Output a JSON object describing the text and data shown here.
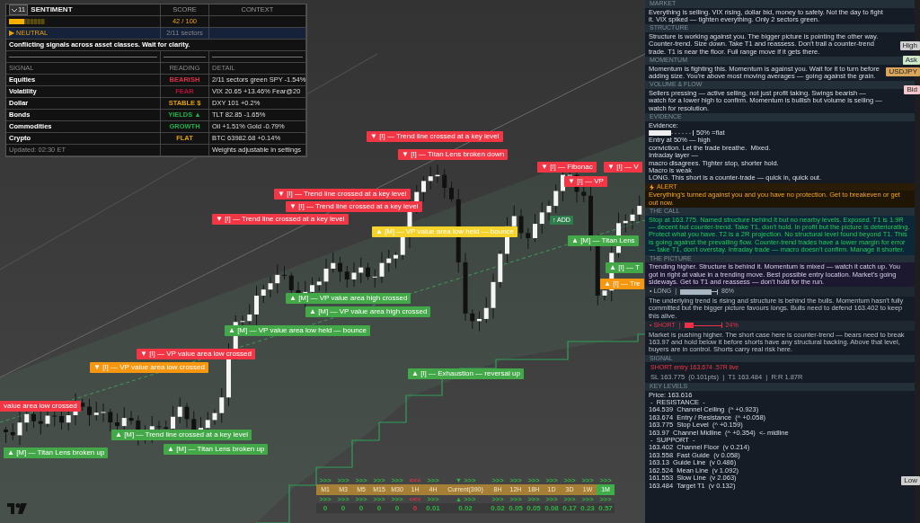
{
  "sentiment": {
    "badge": "11",
    "title": "SENTIMENT",
    "score_header": "SCORE",
    "context_header": "CONTEXT",
    "level": 0.42,
    "score": "42 / 100",
    "state": "▶ NEUTRAL",
    "sectors": "2/11 sectors",
    "summary": "Conflicting signals across asset classes. Wait for clarity.",
    "columns": [
      "SIGNAL",
      "READING",
      "DETAIL"
    ],
    "rows": [
      {
        "signal": "Equities",
        "reading": "BEARISH",
        "color": "#d9304a",
        "detail": "2/11 sectors green  SPY -1.54%"
      },
      {
        "signal": "Volatility",
        "reading": "FEAR",
        "color": "#b0143c",
        "detail": "VIX 20.65  +13.46%  Fear@20"
      },
      {
        "signal": "Dollar",
        "reading": "STABLE $",
        "color": "#e0a010",
        "detail": "DXY 101  +0.2%"
      },
      {
        "signal": "Bonds",
        "reading": "YIELDS ▲",
        "color": "#22b04a",
        "detail": "TLT 82.85  -1.65%"
      },
      {
        "signal": "Commodities",
        "reading": "GROWTH",
        "color": "#22b04a",
        "detail": "Oil +1.51%  Gold -0.79%"
      },
      {
        "signal": "Crypto",
        "reading": "FLAT",
        "color": "#e0a010",
        "detail": "BTC 63982.68  +0.14%"
      }
    ],
    "updated": "Updated: 02:30 ET",
    "note": "Weights adjustable in settings"
  },
  "signals": [
    {
      "text": "▼ [I] — Trend line crossed at a key level",
      "color": "#f23645"
    },
    {
      "text": "▼ [I] — Titan Lens broken down",
      "color": "#f23645"
    },
    {
      "text": "▼ [I] — Trend line crossed at a key level",
      "color": "#f23645"
    },
    {
      "text": "▼ [I] — Trend line crossed at a key level",
      "color": "#f23645"
    },
    {
      "text": "▼ [I] — Trend line crossed at a key level",
      "color": "#f23645"
    },
    {
      "text": "▲ [M] — VP value area low held — bounce",
      "color": "#f5d32a"
    },
    {
      "text": "▲ [M] — VP value area high crossed",
      "color": "#43a847"
    },
    {
      "text": "▲ [M] — VP value area high crossed",
      "color": "#43a847"
    },
    {
      "text": "▲ [M] — VP value area low held — bounce",
      "color": "#43a847"
    },
    {
      "text": "▼ [I] — VP value area low crossed",
      "color": "#f23645"
    },
    {
      "text": "▼ [I] — VP value area low crossed",
      "color": "#f7960f"
    },
    {
      "text": "value area low crossed",
      "color": "#f23645"
    },
    {
      "text": "▲ [I] — Exhaustion — reversal up",
      "color": "#43a847"
    },
    {
      "text": "▲ [M] — Trend line crossed at a key level",
      "color": "#43a847"
    },
    {
      "text": "▲ [M] — Titan Lens broken up",
      "color": "#43a847"
    },
    {
      "text": "▲ [M] — Titan Lens broken up",
      "color": "#43a847"
    },
    {
      "text": "▼ [I] — Fibonac",
      "color": "#f23645"
    },
    {
      "text": "▼ [I] — V",
      "color": "#f23645"
    },
    {
      "text": "▼ [I] — VP",
      "color": "#f23645"
    },
    {
      "text": "▲ [M] — Titan Lens",
      "color": "#43a847"
    },
    {
      "text": "▲ [I] — T",
      "color": "#43a847"
    },
    {
      "text": "▲ [I] — Tre",
      "color": "#f7960f"
    },
    {
      "text": "↑ ADD",
      "color": "#2e7d4a"
    }
  ],
  "timeframes": [
    {
      "label": "M1",
      "selected": false,
      "kind": "up",
      "top": ">>>",
      "bottom": ">>>",
      "value": "0"
    },
    {
      "label": "M3",
      "selected": false,
      "kind": "up",
      "top": ">>>",
      "bottom": ">>>",
      "value": "0"
    },
    {
      "label": "M5",
      "selected": false,
      "kind": "up",
      "top": ">>>",
      "bottom": ">>>",
      "value": "0"
    },
    {
      "label": "M15",
      "selected": false,
      "kind": "up",
      "top": ">>>",
      "bottom": ">>>",
      "value": "0"
    },
    {
      "label": "M30",
      "selected": false,
      "kind": "up",
      "top": ">>>",
      "bottom": ">>>",
      "value": "0"
    },
    {
      "label": "1H",
      "selected": false,
      "kind": "down",
      "top": "<<<",
      "bottom": "<<<",
      "value": "0"
    },
    {
      "label": "4H",
      "selected": false,
      "kind": "up",
      "top": ">>>",
      "bottom": ">>>",
      "value": "0.01"
    },
    {
      "label": "Current(390)",
      "selected": false,
      "kind": "up",
      "top": ">>>",
      "bottom": ">>>",
      "marker_top": "▼",
      "marker_bottom": "▲",
      "value": "0.02"
    },
    {
      "label": "8H",
      "selected": false,
      "kind": "up",
      "top": ">>>",
      "bottom": ">>>",
      "value": "0.02"
    },
    {
      "label": "12H",
      "selected": false,
      "kind": "up",
      "top": ">>>",
      "bottom": ">>>",
      "value": "0.05"
    },
    {
      "label": "18H",
      "selected": false,
      "kind": "up",
      "top": ">>>",
      "bottom": ">>>",
      "value": "0.05"
    },
    {
      "label": "1D",
      "selected": false,
      "kind": "up",
      "top": ">>>",
      "bottom": ">>>",
      "value": "0.08"
    },
    {
      "label": "3D",
      "selected": false,
      "kind": "up",
      "top": ">>>",
      "bottom": ">>>",
      "value": "0.17"
    },
    {
      "label": "1W",
      "selected": false,
      "kind": "up",
      "top": ">>>",
      "bottom": ">>>",
      "value": "0.23"
    },
    {
      "label": "1M",
      "selected": true,
      "kind": "up",
      "top": ">>>",
      "bottom": ">>>",
      "value": "0.57"
    }
  ],
  "sections": [
    {
      "kind": "note",
      "title": "MARKET",
      "text": "Everything is selling. VIX rising, dollar bid, money to safety. Not the day to fight it. VIX spiked — tighten everything. Only 2 sectors green."
    },
    {
      "kind": "note",
      "title": "STRUCTURE",
      "text": "Structure is working against you. The bigger picture is pointing the other way. Counter-trend. Size down. Take T1 and reassess. Don't trail a counter-trend trade. T1 is near the floor. Full range move if it gets there."
    },
    {
      "kind": "note",
      "title": "MOMENTUM",
      "text": "Momentum is fighting this. Momentum is against you. Wait for it to turn before adding size. You're above most moving averages — going against the grain."
    },
    {
      "kind": "note",
      "title": "VOLUME & FLOW",
      "text": "Sellers pressing — active selling, not just profit taking. Swings bearish — watch for a lower high to confirm. Momentum is bullish but volume is selling — watch for resolution."
    },
    {
      "kind": "lines",
      "title": "EVIDENCE",
      "lines": [
        {
          "kind": "text",
          "text": "Evidence:"
        },
        {
          "kind": "meter",
          "level": 0.5,
          "reading": "50% =flat"
        },
        {
          "kind": "text",
          "text": "Entry at 50% — high"
        },
        {
          "kind": "text",
          "text": "conviction. Let the trade breathe.  Mixed."
        },
        {
          "kind": "text",
          "text": "Intraday layer —"
        },
        {
          "kind": "text",
          "text": "macro disagrees. Tighter stop, shorter hold."
        },
        {
          "kind": "text",
          "text": "Macro is weak"
        },
        {
          "kind": "text",
          "text": "LONG. This short is a counter-trade — quick in, quick out."
        }
      ]
    },
    {
      "kind": "alert",
      "title": "ALERT",
      "text": "Everything's turned against you and you have no protection. Get to breakeven or get out now."
    },
    {
      "kind": "call",
      "title": "THE CALL",
      "text": "Stop at 163.775. Named structure behind it but no nearby levels. Exposed. T1 is 1.9R — decent but counter-trend. Take T1, don't hold. In profit but the picture is deteriorating. Protect what you have. T2 is a 2R projection. No structural level found beyond T1. This is going against the prevailing flow. Counter-trend trades have a lower margin for error — take T1, don't overstay. Intraday trade — macro doesn't confirm. Manage it shorter."
    },
    {
      "kind": "picture",
      "title": "THE PICTURE",
      "text": "Trending higher. Structure is behind it. Momentum is mixed — watch it catch up. You got in right at value in a trending move. Best possible entry location. Market's going sideways. Get to T1 and reassess — don't hold for the run."
    },
    {
      "kind": "long",
      "label": "• LONG",
      "separator": "|",
      "level": 0.86,
      "reading": "86%",
      "text": "The underlying trend is rising and structure is behind the bulls. Momentum hasn't fully committed but the bigger picture favours longs. Bulls need to defend 163.402 to keep this alive."
    },
    {
      "kind": "short",
      "label": "• SHORT",
      "separator": "|",
      "level": 0.24,
      "reading": "24%",
      "text": "Market is pushing higher. The short case here is counter-trend — bears need to break 163.97 and hold below it before shorts have any structural backing. Above that level, buyers are in control. Shorts carry real risk here."
    },
    {
      "kind": "signal",
      "title": "SIGNAL",
      "headline": "SHORT  entry 163.674  .57R live",
      "details": "SL 163.775  (0.101pts)  |  T1 163.484  |  R:R 1.87R"
    },
    {
      "kind": "lines",
      "title": "KEY LEVELS",
      "lines": [
        {
          "kind": "text",
          "text": "Price: 163.616"
        },
        {
          "kind": "text",
          "text": " -  RESISTANCE  -"
        },
        {
          "kind": "text",
          "text": "164.539  Channel Ceiling  (^ +0.923)"
        },
        {
          "kind": "text",
          "text": "163.674  Entry / Resistance  (^ +0.058)"
        },
        {
          "kind": "text",
          "text": "163.775  Stop Level  (^ +0.159)"
        },
        {
          "kind": "text",
          "text": "163.97  Channel Midline  (^ +0.354)  <- midline"
        },
        {
          "kind": "text",
          "text": " -  SUPPORT  -"
        },
        {
          "kind": "text",
          "text": "163.402  Channel Floor  (v 0.214)"
        },
        {
          "kind": "text",
          "text": "163.558  Fast Guide  (v 0.058)"
        },
        {
          "kind": "text",
          "text": "163.13  Guide Line  (v 0.486)"
        },
        {
          "kind": "text",
          "text": "162.524  Mean Line  (v 1.092)"
        },
        {
          "kind": "text",
          "text": "161.553  Slow Line  (v 2.063)"
        },
        {
          "kind": "text",
          "text": "163.484  Target T1  (v 0.132)"
        }
      ]
    }
  ],
  "price_tags": [
    {
      "kind": "high",
      "text": "High"
    },
    {
      "kind": "ask",
      "text": "Ask"
    },
    {
      "kind": "symbol",
      "text": "USDJPY"
    },
    {
      "kind": "bid",
      "text": "Bid"
    },
    {
      "kind": "low",
      "text": "Low"
    }
  ]
}
